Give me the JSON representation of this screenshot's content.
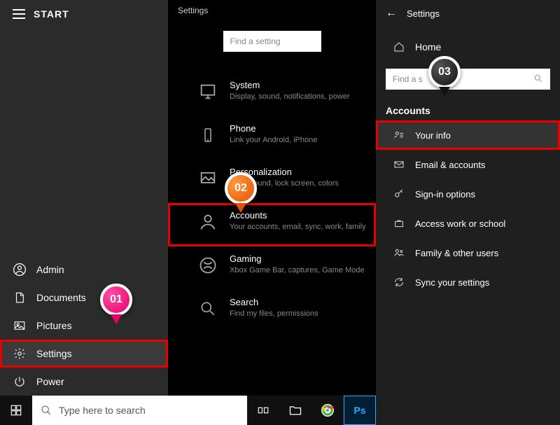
{
  "callouts": {
    "b01": "01",
    "b02": "02",
    "b03": "03"
  },
  "start": {
    "title": "START",
    "items": {
      "admin": "Admin",
      "documents": "Documents",
      "pictures": "Pictures",
      "settings": "Settings",
      "power": "Power"
    }
  },
  "taskbar": {
    "search_placeholder": "Type here to search"
  },
  "settings_panel": {
    "header": "Settings",
    "search_placeholder": "Find a setting",
    "categories": {
      "system": {
        "title": "System",
        "desc": "Display, sound, notifications, power"
      },
      "phone": {
        "title": "Phone",
        "desc": "Link your Android, iPhone"
      },
      "personalization": {
        "title": "Personalization",
        "desc": "Background, lock screen, colors"
      },
      "accounts": {
        "title": "Accounts",
        "desc": "Your accounts, email, sync, work, family"
      },
      "gaming": {
        "title": "Gaming",
        "desc": "Xbox Game Bar, captures, Game Mode"
      },
      "search": {
        "title": "Search",
        "desc": "Find my files, permissions"
      }
    }
  },
  "accounts_panel": {
    "header": "Settings",
    "home": "Home",
    "search_placeholder": "Find a s",
    "section": "Accounts",
    "items": {
      "your_info": "Your info",
      "email": "Email & accounts",
      "signin": "Sign-in options",
      "work": "Access work or school",
      "family": "Family & other users",
      "sync": "Sync your settings"
    }
  }
}
